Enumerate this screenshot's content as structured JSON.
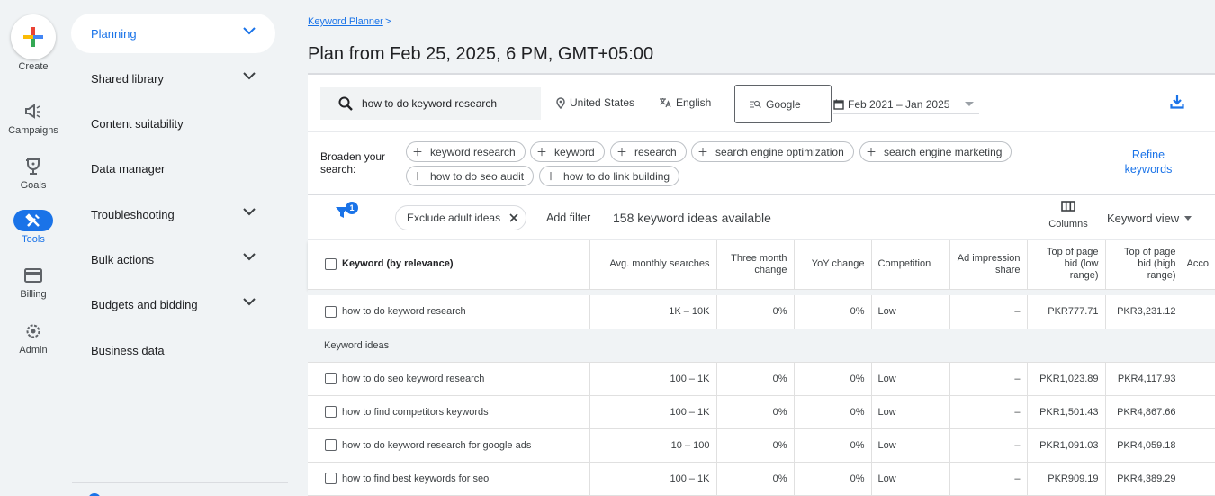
{
  "rail": {
    "create_label": "Create",
    "items": [
      {
        "label": "Campaigns",
        "icon": "megaphone-icon"
      },
      {
        "label": "Goals",
        "icon": "trophy-icon"
      },
      {
        "label": "Tools",
        "icon": "tools-icon",
        "active": true
      },
      {
        "label": "Billing",
        "icon": "credit-card-icon"
      },
      {
        "label": "Admin",
        "icon": "gear-icon"
      }
    ]
  },
  "nav": {
    "items": [
      {
        "label": "Planning",
        "expandable": true,
        "active": true
      },
      {
        "label": "Shared library",
        "expandable": true
      },
      {
        "label": "Content suitability",
        "expandable": false
      },
      {
        "label": "Data manager",
        "expandable": false
      },
      {
        "label": "Troubleshooting",
        "expandable": true
      },
      {
        "label": "Bulk actions",
        "expandable": true
      },
      {
        "label": "Budgets and bidding",
        "expandable": true
      },
      {
        "label": "Business data",
        "expandable": false
      }
    ]
  },
  "header": {
    "breadcrumb": "Keyword Planner",
    "breadcrumb_sep": ">",
    "title": "Plan from Feb 25, 2025, 6 PM, GMT+05:00"
  },
  "search": {
    "query": "how to do keyword research",
    "location": "United States",
    "language": "English",
    "network": "Google",
    "date_range": "Feb 2021 – Jan 2025"
  },
  "broaden": {
    "label": "Broaden your search:",
    "chips": [
      "keyword research",
      "keyword",
      "research",
      "search engine optimization",
      "search engine marketing",
      "how to do seo audit",
      "how to do link building"
    ],
    "refine_label": "Refine keywords"
  },
  "filters": {
    "badge_count": "1",
    "active_filter": "Exclude adult ideas",
    "add_filter_label": "Add filter",
    "ideas_count": "158 keyword ideas available",
    "columns_label": "Columns",
    "view_label": "Keyword view"
  },
  "table": {
    "headers": [
      "Keyword (by relevance)",
      "Avg. monthly searches",
      "Three month change",
      "YoY change",
      "Competition",
      "Ad impression share",
      "Top of page bid (low range)",
      "Top of page bid (high range)",
      "Acco"
    ],
    "provided": [
      {
        "keyword": "how to do keyword research",
        "searches": "1K – 10K",
        "three_month": "0%",
        "yoy": "0%",
        "competition": "Low",
        "impression_share": "–",
        "bid_low": "PKR777.71",
        "bid_high": "PKR3,231.12",
        "account": ""
      }
    ],
    "section_label": "Keyword ideas",
    "ideas": [
      {
        "keyword": "how to do seo keyword research",
        "searches": "100 – 1K",
        "three_month": "0%",
        "yoy": "0%",
        "competition": "Low",
        "impression_share": "–",
        "bid_low": "PKR1,023.89",
        "bid_high": "PKR4,117.93",
        "account": ""
      },
      {
        "keyword": "how to find competitors keywords",
        "searches": "100 – 1K",
        "three_month": "0%",
        "yoy": "0%",
        "competition": "Low",
        "impression_share": "–",
        "bid_low": "PKR1,501.43",
        "bid_high": "PKR4,867.66",
        "account": ""
      },
      {
        "keyword": "how to do keyword research for google ads",
        "searches": "10 – 100",
        "three_month": "0%",
        "yoy": "0%",
        "competition": "Low",
        "impression_share": "–",
        "bid_low": "PKR1,091.03",
        "bid_high": "PKR4,059.18",
        "account": ""
      },
      {
        "keyword": "how to find best keywords for seo",
        "searches": "100 – 1K",
        "three_month": "0%",
        "yoy": "0%",
        "competition": "Low",
        "impression_share": "–",
        "bid_low": "PKR909.19",
        "bid_high": "PKR4,389.29",
        "account": ""
      }
    ]
  },
  "colors": {
    "accent": "#1a73e8",
    "background": "#f0f3f5"
  }
}
